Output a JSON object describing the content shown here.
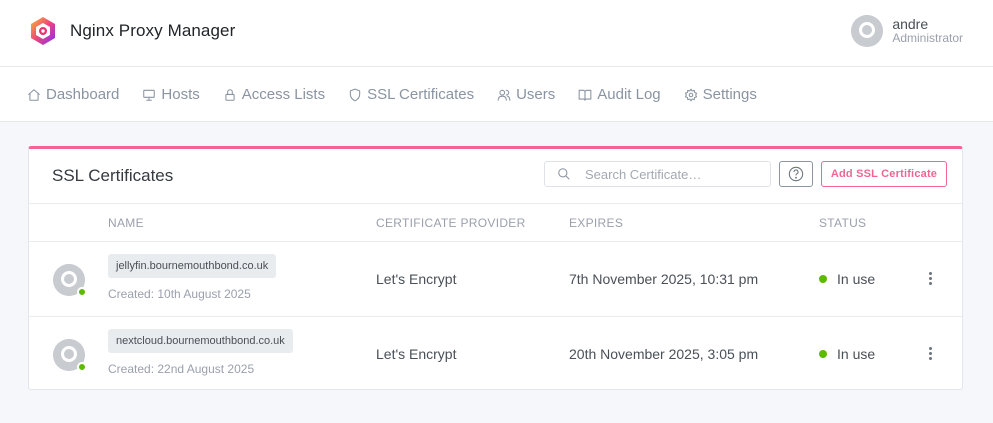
{
  "app": {
    "title": "Nginx Proxy Manager"
  },
  "user": {
    "name": "andre",
    "role": "Administrator"
  },
  "nav": [
    {
      "label": "Dashboard",
      "icon": "home-icon"
    },
    {
      "label": "Hosts",
      "icon": "monitor-icon"
    },
    {
      "label": "Access Lists",
      "icon": "lock-icon"
    },
    {
      "label": "SSL Certificates",
      "icon": "shield-icon"
    },
    {
      "label": "Users",
      "icon": "users-icon"
    },
    {
      "label": "Audit Log",
      "icon": "book-icon"
    },
    {
      "label": "Settings",
      "icon": "gear-icon"
    }
  ],
  "card": {
    "title": "SSL Certificates",
    "search_placeholder": "Search Certificate…",
    "add_label": "Add SSL Certificate",
    "accent": "#f06595"
  },
  "table": {
    "headers": [
      "NAME",
      "CERTIFICATE PROVIDER",
      "EXPIRES",
      "STATUS"
    ],
    "rows": [
      {
        "domain": "jellyfin.bournemouthbond.co.uk",
        "created": "Created: 10th August 2025",
        "provider": "Let's Encrypt",
        "expires": "7th November 2025, 10:31 pm",
        "status": "In use"
      },
      {
        "domain": "nextcloud.bournemouthbond.co.uk",
        "created": "Created: 22nd August 2025",
        "provider": "Let's Encrypt",
        "expires": "20th November 2025, 3:05 pm",
        "status": "In use"
      }
    ]
  },
  "colors": {
    "status_ok": "#5eba00",
    "brand": "#f06595"
  }
}
